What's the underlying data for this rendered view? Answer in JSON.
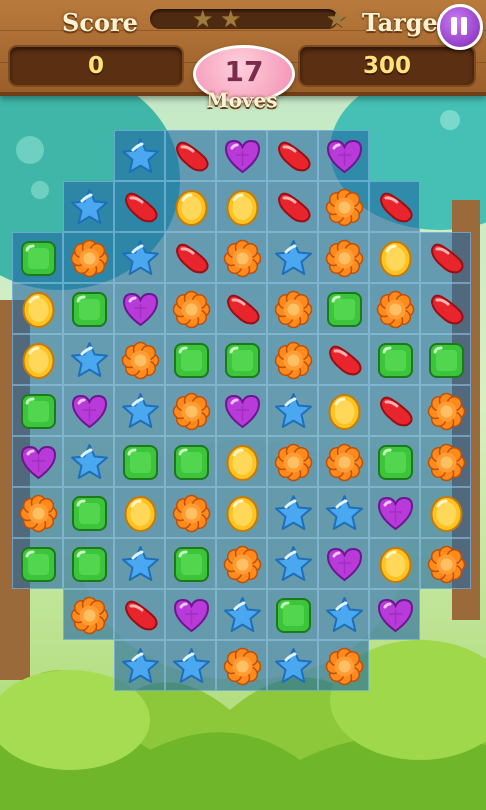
{
  "hud": {
    "score_label": "Score",
    "score_value": "0",
    "target_label": "Target",
    "target_value": "300",
    "moves_count": "17",
    "moves_label": "Moves",
    "stars_total": 3,
    "progress_fraction": 0.0
  },
  "colors": {
    "star": "#4aa8f0",
    "bean": "#e8242c",
    "heart": "#b83ad8",
    "coin": "#ffc21e",
    "flower": "#ff8a1c",
    "square": "#3cc43a"
  },
  "board": {
    "columns": 9,
    "rows": 11,
    "cells": [
      [
        null,
        null,
        "star",
        "bean",
        "heart",
        "bean",
        "heart",
        null,
        null
      ],
      [
        null,
        "star",
        "bean",
        "coin",
        "coin",
        "bean",
        "flower",
        "bean",
        null
      ],
      [
        "square",
        "flower",
        "star",
        "bean",
        "flower",
        "star",
        "flower",
        "coin",
        "bean"
      ],
      [
        "coin",
        "square",
        "heart",
        "flower",
        "bean",
        "flower",
        "square",
        "flower",
        "bean"
      ],
      [
        "coin",
        "star",
        "flower",
        "square",
        "square",
        "flower",
        "bean",
        "square",
        "square"
      ],
      [
        "square",
        "heart",
        "star",
        "flower",
        "heart",
        "star",
        "coin",
        "bean",
        "flower"
      ],
      [
        "heart",
        "star",
        "square",
        "square",
        "coin",
        "flower",
        "flower",
        "square",
        "flower"
      ],
      [
        "flower",
        "square",
        "coin",
        "flower",
        "coin",
        "star",
        "star",
        "heart",
        "coin"
      ],
      [
        "square",
        "square",
        "star",
        "square",
        "flower",
        "star",
        "heart",
        "coin",
        "flower"
      ],
      [
        null,
        "flower",
        "bean",
        "heart",
        "star",
        "square",
        "star",
        "heart",
        null
      ],
      [
        null,
        null,
        "star",
        "star",
        "flower",
        "star",
        "flower",
        null,
        null
      ]
    ]
  }
}
